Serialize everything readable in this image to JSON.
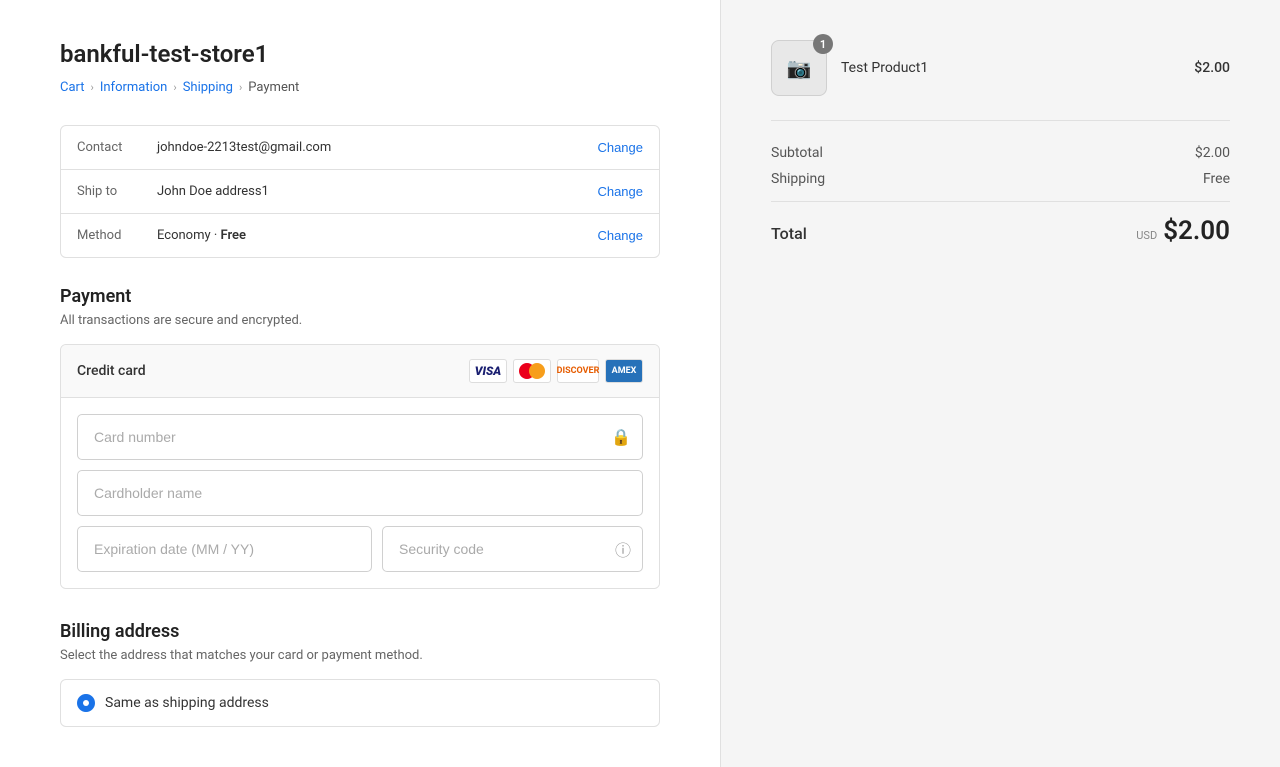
{
  "store": {
    "title": "bankful-test-store1"
  },
  "breadcrumb": {
    "cart": "Cart",
    "information": "Information",
    "shipping": "Shipping",
    "current": "Payment"
  },
  "info": {
    "contact_label": "Contact",
    "contact_value": "johndoe-2213test@gmail.com",
    "ship_to_label": "Ship to",
    "ship_to_value": "John Doe address1",
    "method_label": "Method",
    "method_value_plain": "Economy · ",
    "method_value_bold": "Free",
    "change_label": "Change"
  },
  "payment": {
    "title": "Payment",
    "subtitle": "All transactions are secure and encrypted.",
    "method_label": "Credit card",
    "card_icons": [
      "VISA",
      "MC",
      "DISCOVER",
      "AMEX"
    ],
    "card_number_placeholder": "Card number",
    "cardholder_placeholder": "Cardholder name",
    "expiry_placeholder": "Expiration date (MM / YY)",
    "security_placeholder": "Security code"
  },
  "billing": {
    "title": "Billing address",
    "subtitle": "Select the address that matches your card or payment method.",
    "same_as_shipping_label": "Same as shipping address"
  },
  "order": {
    "product_name": "Test Product1",
    "product_price": "$2.00",
    "badge_count": "1",
    "subtotal_label": "Subtotal",
    "subtotal_value": "$2.00",
    "shipping_label": "Shipping",
    "shipping_value": "Free",
    "total_label": "Total",
    "total_currency": "USD",
    "total_value": "$2.00"
  }
}
